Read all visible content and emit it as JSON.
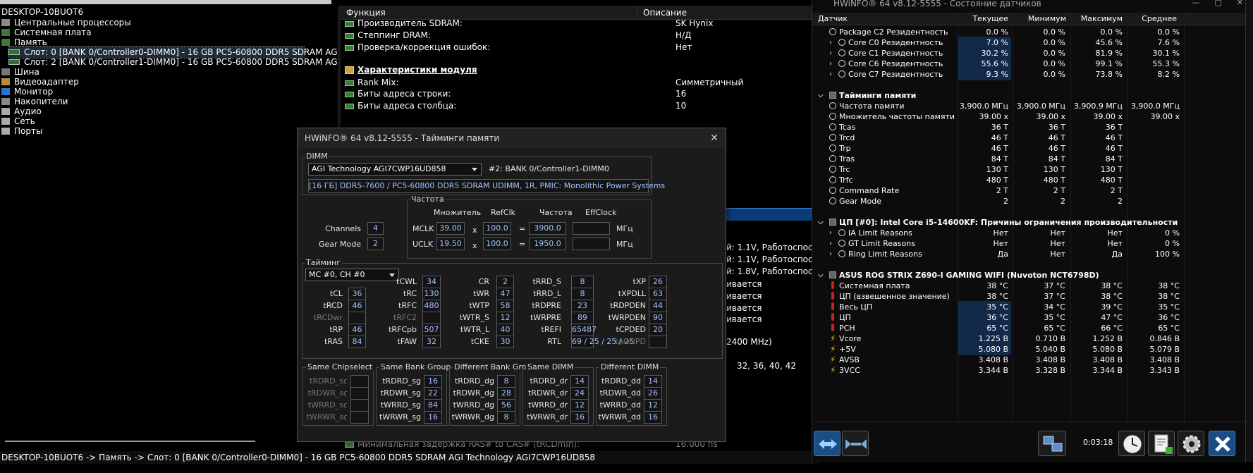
{
  "main": {
    "tree": {
      "root": "DESKTOP-10BUOT6",
      "items": [
        {
          "label": "Центральные процессоры",
          "icon": "cpu-icon"
        },
        {
          "label": "Системная плата",
          "icon": "motherboard-icon"
        },
        {
          "label": "Память",
          "icon": "memory-icon"
        },
        {
          "label": "Слот: 0 [BANK 0/Controller0-DIMM0] - 16 GB PC5-60800 DDR5 SDRAM AGI Tec",
          "icon": "ram-module-icon"
        },
        {
          "label": "Слот: 2 [BANK 0/Controller1-DIMM0] - 16 GB PC5-60800 DDR5 SDRAM AGI Tec",
          "icon": "ram-module-icon"
        },
        {
          "label": "Шина",
          "icon": "bus-icon"
        },
        {
          "label": "Видеоадаптер",
          "icon": "gpu-icon"
        },
        {
          "label": "Монитор",
          "icon": "monitor-icon"
        },
        {
          "label": "Накопители",
          "icon": "drive-icon"
        },
        {
          "label": "Аудио",
          "icon": "audio-icon"
        },
        {
          "label": "Сеть",
          "icon": "network-icon"
        },
        {
          "label": "Порты",
          "icon": "ports-icon"
        }
      ]
    },
    "details": {
      "col_function": "Функция",
      "col_description": "Описание",
      "rows": [
        {
          "f": "Производитель SDRAM:",
          "d": "SK Hynix"
        },
        {
          "f": "Степпинг DRAM:",
          "d": "Н/Д"
        },
        {
          "f": "Проверка/коррекция ошибок:",
          "d": "Нет"
        },
        {
          "f": "Характеристики модуля",
          "d": "",
          "section": true
        },
        {
          "f": "Rank Mix:",
          "d": "Симметричный"
        },
        {
          "f": "Биты адреса строки:",
          "d": "16"
        },
        {
          "f": "Биты адреса столбца:",
          "d": "10"
        }
      ],
      "right_fragments": [
        "й: 1.1V, Работоспосо",
        "й: 1.1V, Работоспосо",
        "й: 1.8V, Работоспосо",
        "ивается",
        "ивается",
        "ивается",
        "ивается",
        "2400 MHz)",
        "32, 36, 40, 42"
      ],
      "partial_row_f": "Минимальная задержка RAS# to CAS# (tRCDmin):",
      "partial_row_d": "16.000 ns"
    },
    "statusbar": "DESKTOP-10BUOT6 -> Память -> Слот: 0 [BANK 0/Controller0-DIMM0] - 16 GB PC5-60800 DDR5 SDRAM AGI Technology AGI7CWP16UD858"
  },
  "dialog": {
    "title": "HWiNFO® 64 v8.12-5555 - Тайминги памяти",
    "dimm_group": "DIMM",
    "dimm_select": "AGI Technology AGI7CWP16UD858",
    "dimm_slot": "#2: BANK 0/Controller1-DIMM0",
    "dimm_desc": "[16 ГБ] DDR5-7600 / PC5-60800 DDR5 SDRAM UDIMM, 1R, PMIC: Monolithic Power Systems",
    "channels_label": "Channels",
    "channels": "4",
    "gearmode_label": "Gear Mode",
    "gearmode": "2",
    "freq_group": "Частота",
    "h_mult": "Множитель",
    "h_refclk": "RefClk",
    "h_freq": "Частота",
    "h_effclock": "EffClock",
    "mclk_label": "MCLK",
    "mclk_mult": "39.00",
    "mclk_ref": "100.0",
    "mclk_freq": "3900.0",
    "uclk_label": "UCLK",
    "uclk_mult": "19.50",
    "uclk_ref": "100.0",
    "uclk_freq": "1950.0",
    "x_sym": "x",
    "eq_sym": "=",
    "mhz": "МГц",
    "timing_group": "Тайминг",
    "mc_select": "MC #0, CH #0",
    "t": {
      "tCL": "36",
      "tRCD": "46",
      "tRCDwr": "",
      "tRP": "46",
      "tRAS": "84",
      "tCWL": "34",
      "tRC": "130",
      "tRFC": "480",
      "tRFC2": "",
      "tRFCpb": "507",
      "tFAW": "32",
      "CR": "2",
      "tWR": "47",
      "tWTP": "58",
      "tWTR_S": "12",
      "tWTR_L": "40",
      "tCKE": "30",
      "tRRD_S": "8",
      "tRRD_L": "8",
      "tRDPRE": "23",
      "tWRPRE": "89",
      "tREFI": "65487",
      "RTL": "69 / 25 / 25 / 25",
      "tXP": "26",
      "tXPDLL": "63",
      "tRDPDEN": "44",
      "tWRPDEN": "90",
      "tCPDED": "20",
      "tAONPD": ""
    },
    "same_chipselect": "Same Chipselect",
    "same_bank_group": "Same Bank Group",
    "diff_bank_group": "Different Bank Group",
    "same_dimm": "Same DIMM",
    "diff_dimm": "Different DIMM",
    "sc": {
      "tRDRD_sc": "",
      "tRDWR_sc": "",
      "tWRRD_sc": "",
      "tWRWR_sc": ""
    },
    "sg": {
      "tRDRD_sg": "16",
      "tRDWR_sg": "22",
      "tWRRD_sg": "84",
      "tWRWR_sg": "16"
    },
    "dg": {
      "tRDRD_dg": "8",
      "tRDWR_dg": "28",
      "tWRRD_dg": "56",
      "tWRWR_dg": "8"
    },
    "dr": {
      "tRDRD_dr": "14",
      "tRDWR_dr": "24",
      "tWRRD_dr": "12",
      "tWRWR_dr": "16"
    },
    "dd": {
      "tRDRD_dd": "14",
      "tRDWR_dd": "26",
      "tWRRD_dd": "12",
      "tWRWR_dd": "16"
    }
  },
  "sensors": {
    "title": "HWiNFO® 64 v8.12-5555 - Состояние датчиков",
    "cols": {
      "name": "Датчик",
      "cur": "Текущее",
      "min": "Минимум",
      "max": "Максимум",
      "avg": "Среднее"
    },
    "rows": [
      {
        "n": "Package C2 Резидентность",
        "c": "0.0 %",
        "mi": "0.0 %",
        "ma": "0.0 %",
        "a": "0.0 %",
        "icon": "clock",
        "ind": 1
      },
      {
        "n": "Core C0 Резидентность",
        "c": "7.0 %",
        "mi": "0.0 %",
        "ma": "45.6 %",
        "a": "7.6 %",
        "icon": "clock",
        "ind": 2,
        "hl": true
      },
      {
        "n": "Core C1 Резидентность",
        "c": "30.2 %",
        "mi": "0.0 %",
        "ma": "81.9 %",
        "a": "30.1 %",
        "icon": "clock",
        "ind": 2,
        "hl": true
      },
      {
        "n": "Core C6 Резидентность",
        "c": "55.6 %",
        "mi": "0.0 %",
        "ma": "99.1 %",
        "a": "55.3 %",
        "icon": "clock",
        "ind": 2,
        "hl": true
      },
      {
        "n": "Core C7 Резидентность",
        "c": "9.3 %",
        "mi": "0.0 %",
        "ma": "73.8 %",
        "a": "8.2 %",
        "icon": "clock",
        "ind": 2,
        "hl": true
      },
      {
        "n": "",
        "gap": true
      },
      {
        "n": "Тайминги памяти",
        "hdr": true,
        "icon": "disc"
      },
      {
        "n": "Частота памяти",
        "c": "3,900.0 МГц",
        "mi": "3,900.0 МГц",
        "ma": "3,900.9 МГц",
        "a": "3,900.0 МГц",
        "icon": "clock",
        "ind": 1
      },
      {
        "n": "Множитель частоты памяти",
        "c": "39.00 x",
        "mi": "39.00 x",
        "ma": "39.00 x",
        "a": "39.00 x",
        "icon": "clock",
        "ind": 1
      },
      {
        "n": "Tcas",
        "c": "36 T",
        "mi": "36 T",
        "ma": "36 T",
        "a": "",
        "icon": "clock",
        "ind": 1
      },
      {
        "n": "Trcd",
        "c": "46 T",
        "mi": "46 T",
        "ma": "46 T",
        "a": "",
        "icon": "clock",
        "ind": 1
      },
      {
        "n": "Trp",
        "c": "46 T",
        "mi": "46 T",
        "ma": "46 T",
        "a": "",
        "icon": "clock",
        "ind": 1
      },
      {
        "n": "Tras",
        "c": "84 T",
        "mi": "84 T",
        "ma": "84 T",
        "a": "",
        "icon": "clock",
        "ind": 1
      },
      {
        "n": "Trc",
        "c": "130 T",
        "mi": "130 T",
        "ma": "130 T",
        "a": "",
        "icon": "clock",
        "ind": 1
      },
      {
        "n": "Trfc",
        "c": "480 T",
        "mi": "480 T",
        "ma": "480 T",
        "a": "",
        "icon": "clock",
        "ind": 1
      },
      {
        "n": "Command Rate",
        "c": "2 T",
        "mi": "2 T",
        "ma": "2 T",
        "a": "",
        "icon": "clock",
        "ind": 1
      },
      {
        "n": "Gear Mode",
        "c": "2",
        "mi": "2",
        "ma": "2",
        "a": "",
        "icon": "clock",
        "ind": 1
      },
      {
        "n": "",
        "gap": true
      },
      {
        "n": "ЦП [#0]: Intel Core i5-14600KF: Причины ограничения производительности",
        "hdr": true,
        "icon": "disc"
      },
      {
        "n": "IA Limit Reasons",
        "c": "Нет",
        "mi": "Нет",
        "ma": "Нет",
        "a": "0 %",
        "icon": "clock",
        "ind": 2
      },
      {
        "n": "GT Limit Reasons",
        "c": "Нет",
        "mi": "Нет",
        "ma": "Нет",
        "a": "0 %",
        "icon": "clock",
        "ind": 2
      },
      {
        "n": "Ring Limit Reasons",
        "c": "Да",
        "mi": "Нет",
        "ma": "Да",
        "a": "100 %",
        "icon": "clock",
        "ind": 2
      },
      {
        "n": "",
        "gap": true
      },
      {
        "n": "ASUS ROG STRIX Z690-I GAMING WIFI (Nuvoton NCT6798D)",
        "hdr": true,
        "icon": "disc"
      },
      {
        "n": "Системная плата",
        "c": "38 °C",
        "mi": "37 °C",
        "ma": "38 °C",
        "a": "38 °C",
        "icon": "therm",
        "ind": 1
      },
      {
        "n": "ЦП (взвешенное значение)",
        "c": "38 °C",
        "mi": "37 °C",
        "ma": "38 °C",
        "a": "38 °C",
        "icon": "therm",
        "ind": 1
      },
      {
        "n": "Весь ЦП",
        "c": "35 °C",
        "mi": "34 °C",
        "ma": "39 °C",
        "a": "35 °C",
        "icon": "therm",
        "ind": 1,
        "hl": true
      },
      {
        "n": "ЦП",
        "c": "36 °C",
        "mi": "35 °C",
        "ma": "47 °C",
        "a": "36 °C",
        "icon": "therm",
        "ind": 1,
        "hl": true
      },
      {
        "n": "PCH",
        "c": "65 °C",
        "mi": "65 °C",
        "ma": "66 °C",
        "a": "65 °C",
        "icon": "therm",
        "ind": 1,
        "hl": true
      },
      {
        "n": "Vcore",
        "c": "1.225 В",
        "mi": "0.710 В",
        "ma": "1.252 В",
        "a": "0.846 В",
        "icon": "bolt",
        "ind": 1,
        "hl": true
      },
      {
        "n": "+5V",
        "c": "5.080 В",
        "mi": "5.040 В",
        "ma": "5.080 В",
        "a": "5.079 В",
        "icon": "bolt",
        "ind": 1,
        "hl": true
      },
      {
        "n": "AVSB",
        "c": "3.408 В",
        "mi": "3.408 В",
        "ma": "3.408 В",
        "a": "3.408 В",
        "icon": "bolt",
        "ind": 1
      },
      {
        "n": "3VCC",
        "c": "3.344 В",
        "mi": "3.328 В",
        "ma": "3.344 В",
        "a": "3.343 В",
        "icon": "bolt",
        "ind": 1
      }
    ],
    "timer": "0:03:18"
  }
}
